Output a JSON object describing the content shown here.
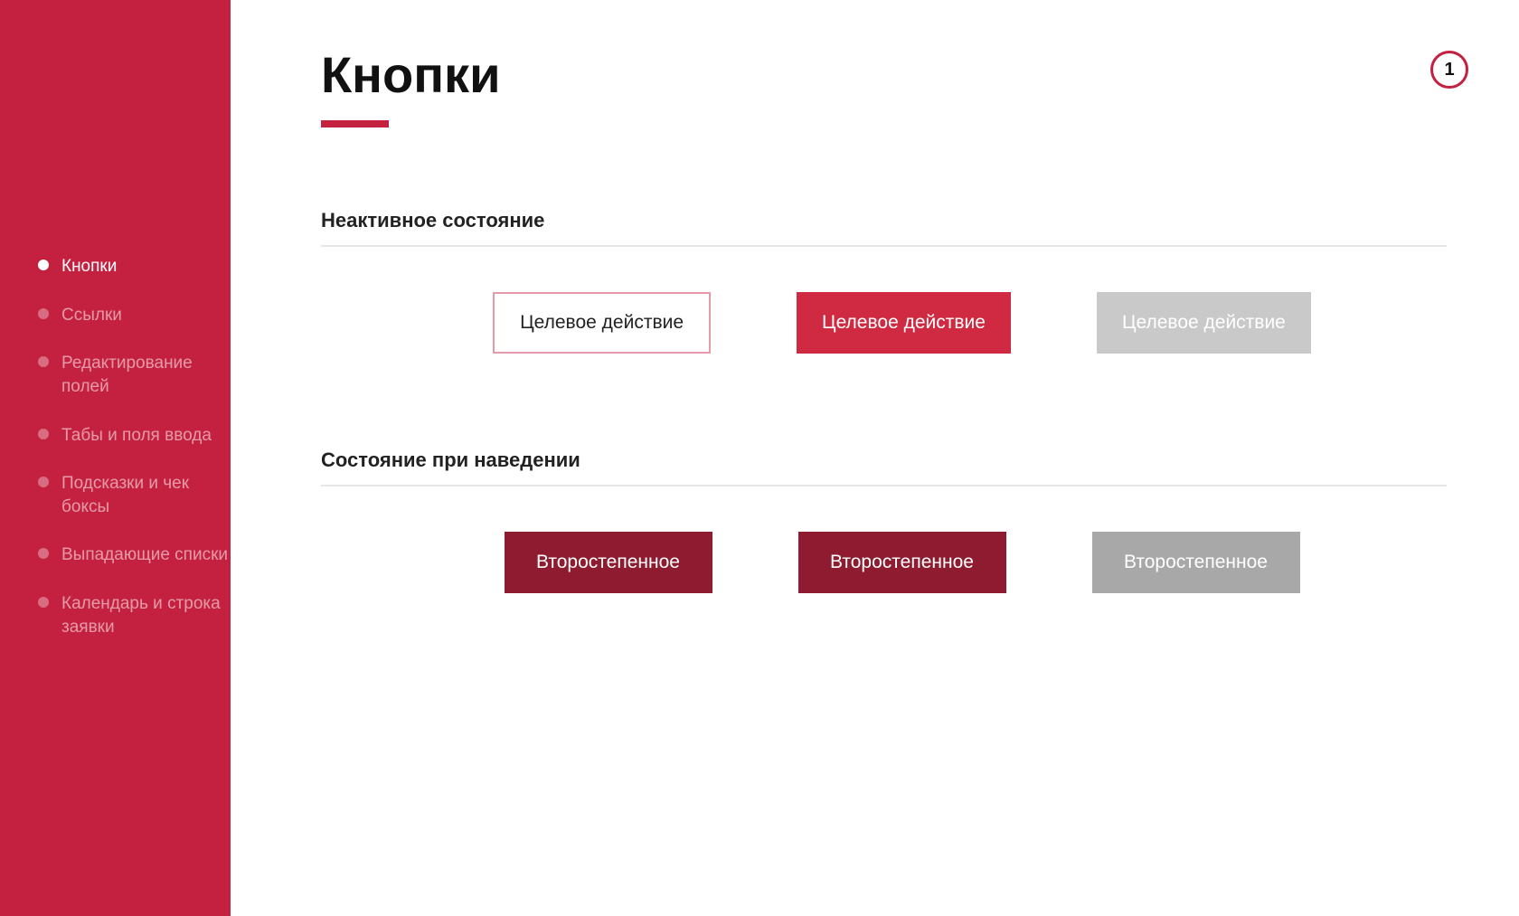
{
  "sidebar": {
    "items": [
      {
        "label": "Кнопки",
        "active": true
      },
      {
        "label": "Ссылки",
        "active": false
      },
      {
        "label": "Редактирование полей",
        "active": false
      },
      {
        "label": "Табы и поля ввода",
        "active": false
      },
      {
        "label": "Подсказки и чек боксы",
        "active": false
      },
      {
        "label": "Выпадающие списки",
        "active": false
      },
      {
        "label": "Календарь и строка заявки",
        "active": false
      }
    ]
  },
  "page": {
    "title": "Кнопки",
    "badge": "1"
  },
  "sections": [
    {
      "heading": "Неактивное состояние",
      "buttons": [
        {
          "label": "Целевое действие",
          "style": "outline"
        },
        {
          "label": "Целевое действие",
          "style": "primary"
        },
        {
          "label": "Целевое действие",
          "style": "disabled"
        }
      ]
    },
    {
      "heading": "Состояние при наведении",
      "buttons": [
        {
          "label": "Второстепенное",
          "style": "hover-1"
        },
        {
          "label": "Второстепенное",
          "style": "hover-2"
        },
        {
          "label": "Второстепенное",
          "style": "hover-disabled"
        }
      ]
    }
  ],
  "colors": {
    "brand": "#c4203f",
    "brand_dark": "#8e1b2f",
    "grey_disabled": "#c9c9c9",
    "grey_hover": "#a8a8a8"
  }
}
